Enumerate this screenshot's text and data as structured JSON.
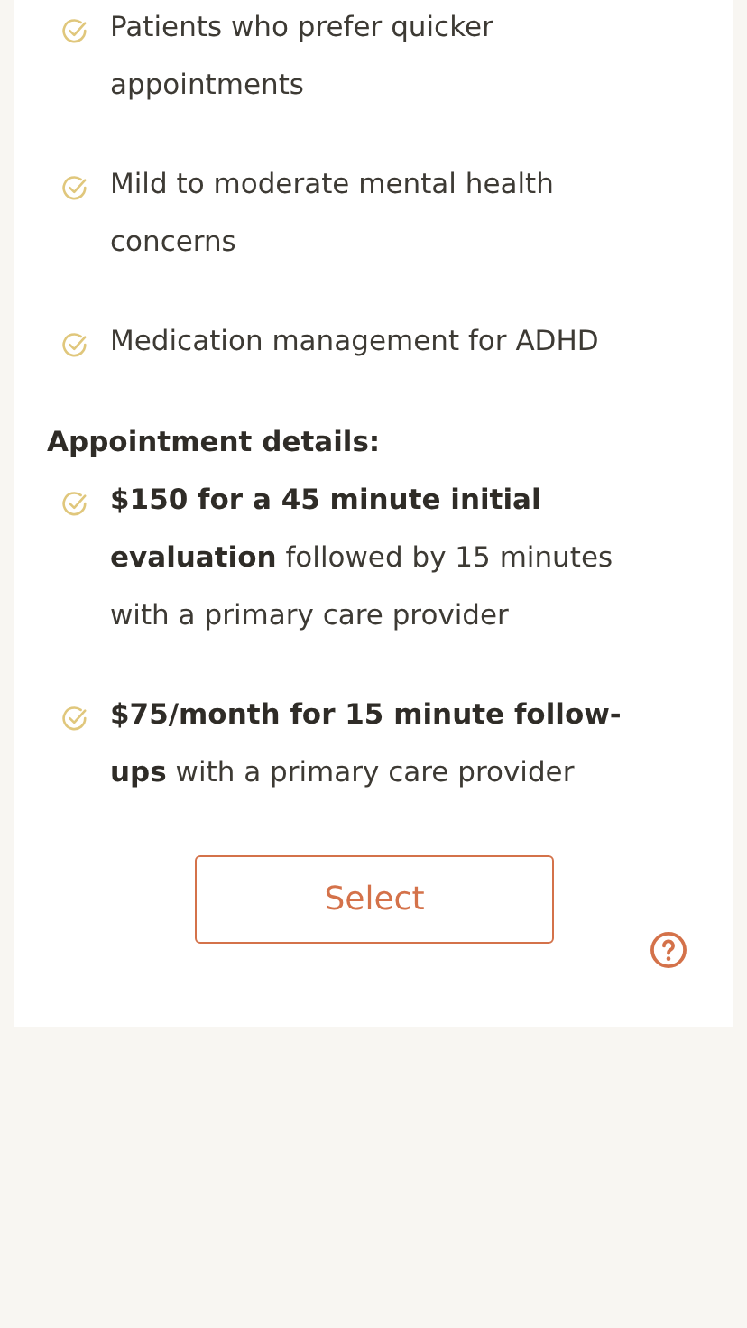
{
  "features": [
    {
      "text": "Patients who prefer quicker appointments"
    },
    {
      "text": "Mild to moderate mental health concerns"
    },
    {
      "text": "Medication management for ADHD"
    }
  ],
  "appointment_heading": "Appointment details:",
  "appointment_details": [
    {
      "text": "**$150 for a 45 minute initial evaluation** followed by 15 minutes with a primary care provider"
    },
    {
      "text": "**$75/month for 15 minute follow-ups** with a primary care provider"
    }
  ],
  "select_button": "Select"
}
